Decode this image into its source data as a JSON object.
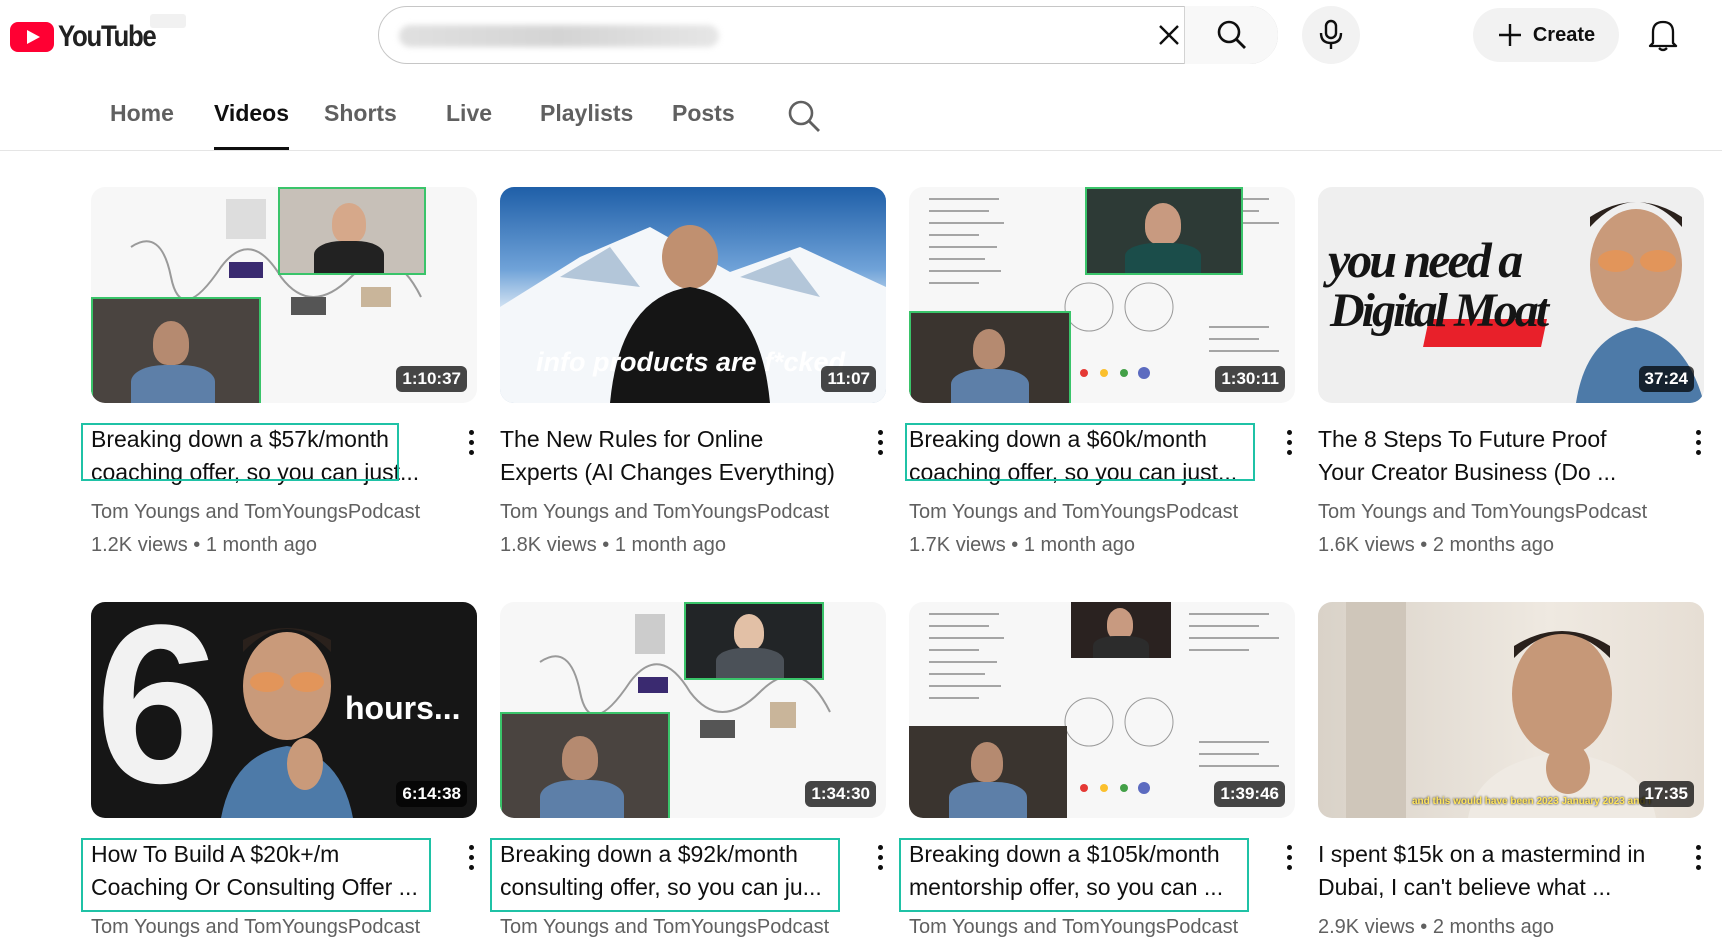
{
  "header": {
    "logo_text": "YouTube",
    "search_value": "",
    "search_placeholder": "",
    "create_label": "Create"
  },
  "tabs": [
    {
      "label": "Home",
      "active": false
    },
    {
      "label": "Videos",
      "active": true
    },
    {
      "label": "Shorts",
      "active": false
    },
    {
      "label": "Live",
      "active": false
    },
    {
      "label": "Playlists",
      "active": false
    },
    {
      "label": "Posts",
      "active": false
    }
  ],
  "colors": {
    "brand": "#ff0033",
    "highlight": "#1fc2a6",
    "pip_border": "#3ac46a"
  },
  "videos": [
    {
      "title_line1": "Breaking down a $57k/month",
      "title_line2": "coaching offer, so you can just...",
      "channel": "Tom Youngs and TomYoungsPodcast",
      "views": "1.2K views",
      "age": "1 month ago",
      "duration": "1:10:37",
      "highlighted": true
    },
    {
      "title_line1": "The New Rules for Online",
      "title_line2": "Experts (AI Changes Everything)",
      "channel": "Tom Youngs and TomYoungsPodcast",
      "views": "1.8K views",
      "age": "1 month ago",
      "duration": "11:07",
      "thumb_text": "info products are f*cked",
      "highlighted": false
    },
    {
      "title_line1": "Breaking down a $60k/month",
      "title_line2": "coaching offer, so you can just...",
      "channel": "Tom Youngs and TomYoungsPodcast",
      "views": "1.7K views",
      "age": "1 month ago",
      "duration": "1:30:11",
      "highlighted": true
    },
    {
      "title_line1": "The 8 Steps To Future Proof",
      "title_line2": "Your Creator Business (Do ...",
      "channel": "Tom Youngs and TomYoungsPodcast",
      "views": "1.6K views",
      "age": "2 months ago",
      "duration": "37:24",
      "thumb_text_1": "you need a",
      "thumb_text_2": "Digital Moat",
      "highlighted": false
    },
    {
      "title_line1": "How To Build A $20k+/m",
      "title_line2": "Coaching Or Consulting Offer ...",
      "channel": "Tom Youngs and TomYoungsPodcast",
      "views": "",
      "age": "",
      "duration": "6:14:38",
      "thumb_text_1": "6",
      "thumb_text_2": "hours...",
      "highlighted": true
    },
    {
      "title_line1": "Breaking down a $92k/month",
      "title_line2": "consulting offer, so you can ju...",
      "channel": "Tom Youngs and TomYoungsPodcast",
      "views": "",
      "age": "",
      "duration": "1:34:30",
      "highlighted": true
    },
    {
      "title_line1": "Breaking down a $105k/month",
      "title_line2": "mentorship offer, so you can ...",
      "channel": "Tom Youngs and TomYoungsPodcast",
      "views": "",
      "age": "",
      "duration": "1:39:46",
      "highlighted": true
    },
    {
      "title_line1": "I spent $15k on a mastermind in",
      "title_line2": "Dubai, I can't believe what ...",
      "channel": "",
      "views": "2.9K views",
      "age": "2 months ago",
      "duration": "17:35",
      "thumb_caption": "and this would have been 2023 January 2023 and I",
      "highlighted": false
    }
  ]
}
